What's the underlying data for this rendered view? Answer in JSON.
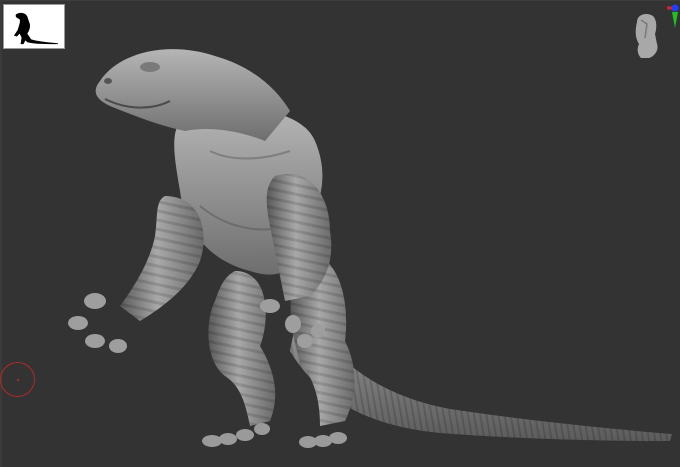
{
  "viewport": {
    "background": "#333333"
  },
  "thumbnail": {
    "icon": "lizard-silhouette-icon",
    "background": "#ffffff"
  },
  "nav_gizmo": {
    "icon": "head-navigation-gizmo-icon",
    "axis_colors": {
      "x": "#e02020",
      "y": "#20c020",
      "z": "#2040ff"
    }
  },
  "brush": {
    "icon": "brush-cursor-ring",
    "color": "#b02a2a"
  },
  "model": {
    "icon": "lizard-creature-sculpt",
    "material_color": "#8c8c8c"
  }
}
